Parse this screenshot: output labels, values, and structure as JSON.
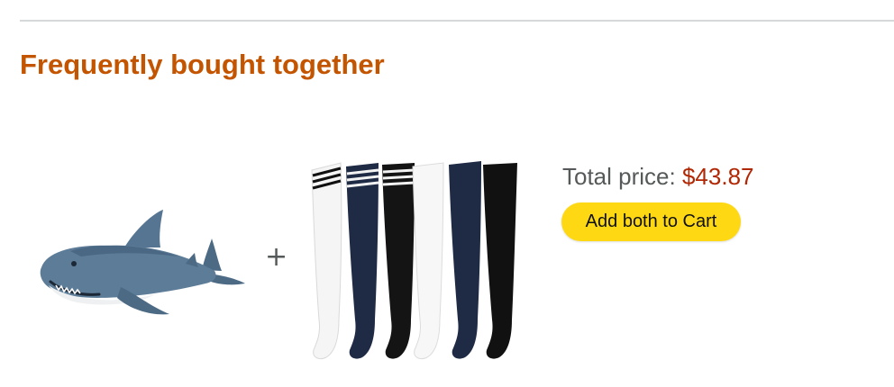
{
  "section": {
    "title": "Frequently bought together"
  },
  "products": [
    {
      "icon": "shark-plush-icon"
    },
    {
      "icon": "thigh-high-socks-icon"
    }
  ],
  "separator": "+",
  "summary": {
    "total_label": "Total price:",
    "total_amount": "$43.87",
    "add_button_label": "Add both to Cart"
  },
  "colors": {
    "title": "#c45500",
    "price": "#b12704",
    "button": "#ffd814",
    "divider": "#d5d9d9"
  }
}
